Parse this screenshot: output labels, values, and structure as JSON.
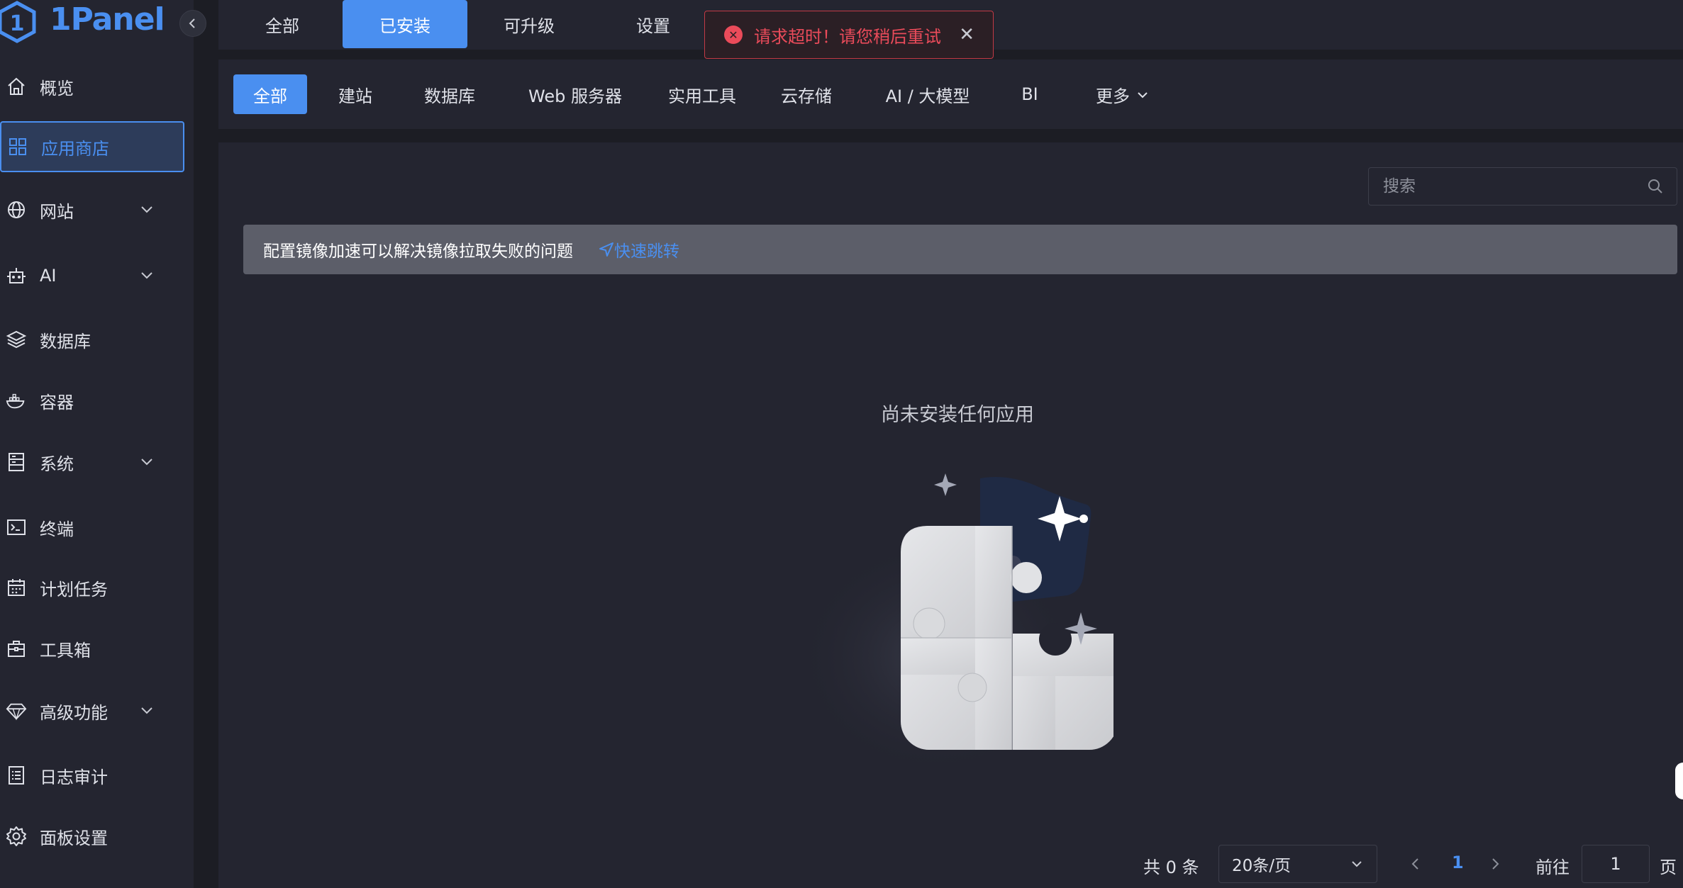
{
  "colors": {
    "accent": "#4a8ff0",
    "error": "#ea4b5a",
    "sidebar_bg": "#242530",
    "page_bg": "#1c1d24"
  },
  "app": {
    "logo_text": "1Panel"
  },
  "sidebar": {
    "items": [
      {
        "label": "概览",
        "icon": "home-icon",
        "expandable": false
      },
      {
        "label": "应用商店",
        "icon": "app-grid-icon",
        "expandable": false,
        "active": true
      },
      {
        "label": "网站",
        "icon": "globe-icon",
        "expandable": true
      },
      {
        "label": "AI",
        "icon": "robot-icon",
        "expandable": true
      },
      {
        "label": "数据库",
        "icon": "layers-icon",
        "expandable": false
      },
      {
        "label": "容器",
        "icon": "docker-icon",
        "expandable": false
      },
      {
        "label": "系统",
        "icon": "server-icon",
        "expandable": true
      },
      {
        "label": "终端",
        "icon": "terminal-icon",
        "expandable": false
      },
      {
        "label": "计划任务",
        "icon": "calendar-icon",
        "expandable": false
      },
      {
        "label": "工具箱",
        "icon": "toolbox-icon",
        "expandable": false
      },
      {
        "label": "高级功能",
        "icon": "diamond-icon",
        "expandable": true
      },
      {
        "label": "日志审计",
        "icon": "log-list-icon",
        "expandable": false
      },
      {
        "label": "面板设置",
        "icon": "gear-icon",
        "expandable": false
      }
    ]
  },
  "top_tabs": [
    {
      "label": "全部"
    },
    {
      "label": "已安装",
      "active": true
    },
    {
      "label": "可升级"
    },
    {
      "label": "设置"
    }
  ],
  "toast": {
    "message": "请求超时！请您稍后重试"
  },
  "categories": [
    {
      "label": "全部",
      "active": true
    },
    {
      "label": "建站"
    },
    {
      "label": "数据库"
    },
    {
      "label": "Web 服务器"
    },
    {
      "label": "实用工具"
    },
    {
      "label": "云存储"
    },
    {
      "label": "AI / 大模型"
    },
    {
      "label": "BI"
    },
    {
      "label": "更多"
    }
  ],
  "search": {
    "placeholder": "搜索",
    "value": ""
  },
  "notice": {
    "text": "配置镜像加速可以解决镜像拉取失败的问题",
    "link_text": "快速跳转"
  },
  "empty_state": {
    "text": "尚未安装任何应用"
  },
  "pagination": {
    "total_text": "共 0 条",
    "page_size": "20条/页",
    "current_page": "1",
    "goto_label": "前往",
    "goto_value": "1",
    "page_suffix": "页"
  }
}
